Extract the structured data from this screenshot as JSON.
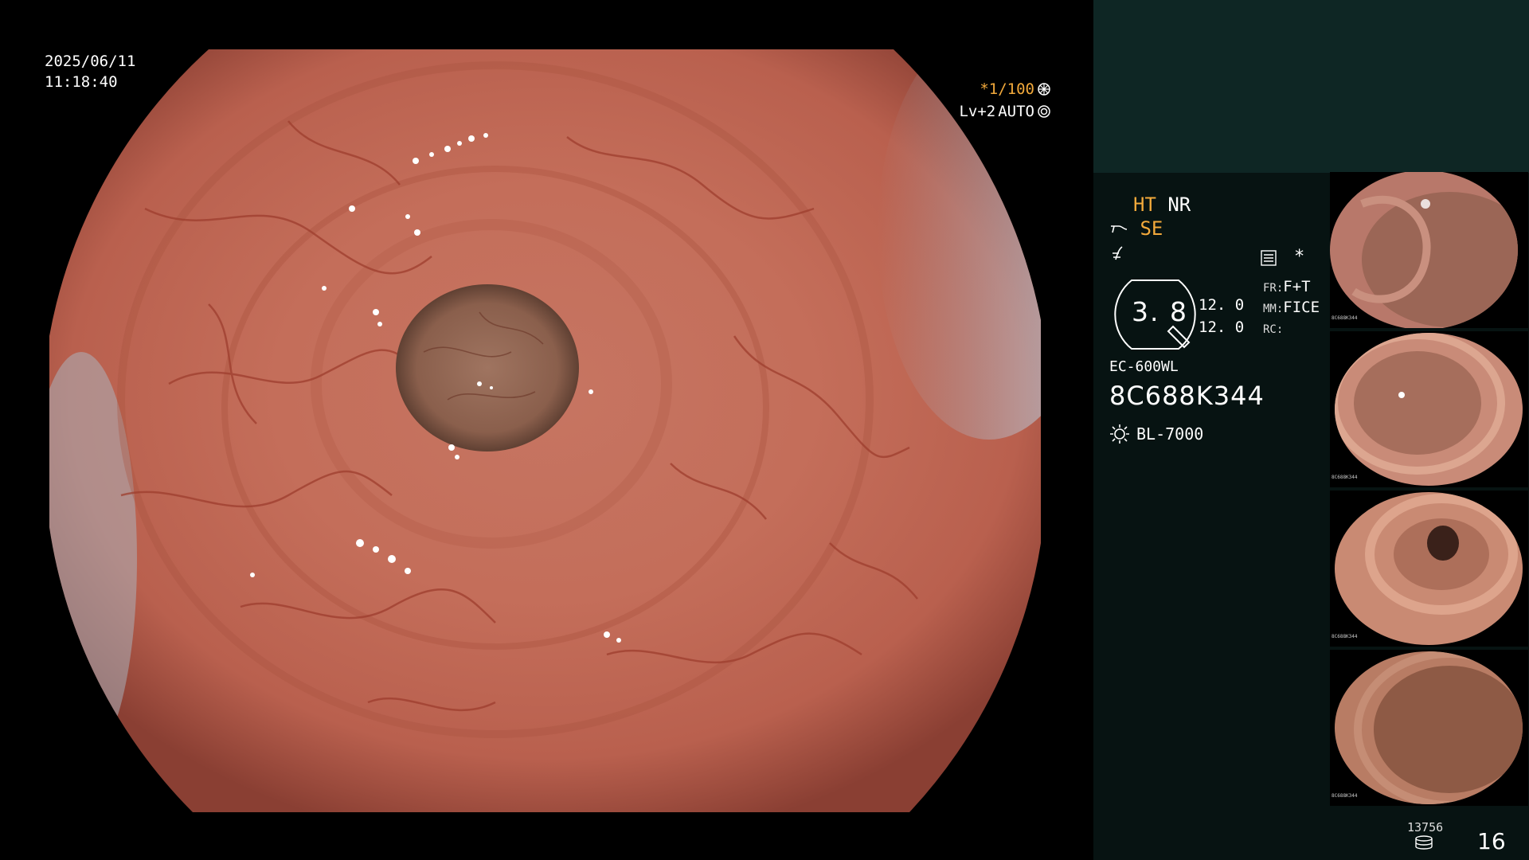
{
  "overlay": {
    "date": "2025/06/11",
    "time": "11:18:40",
    "shutter": "*1/100",
    "level": "Lv+2",
    "mode": "AUTO"
  },
  "panel": {
    "ht": "HT",
    "nr": "NR",
    "se": "SE",
    "asterisk": "*",
    "gauge_value": "3. 8",
    "gauge_num_1": "12. 0",
    "gauge_num_2": "12. 0",
    "fr_key": "FR:",
    "fr_value": "F+T",
    "mm_key": "MM:",
    "mm_value": "FICE",
    "rc_key": "RC:",
    "model": "EC-600WL",
    "serial": "8C688K344",
    "light_source": "BL-7000",
    "thumbnails": [
      {
        "caption": "8C688K344"
      },
      {
        "caption": "8C688K344"
      },
      {
        "caption": "8C688K344"
      },
      {
        "caption": "8C688K344"
      }
    ],
    "image_count": "13756",
    "page_number": "16"
  },
  "colors": {
    "accent": "#f2a93b",
    "panel_bg": "#071312",
    "panel_top": "#0e2624"
  },
  "icons": [
    "shutter-icon",
    "auto-iris-icon",
    "scope-icon",
    "wave-icon",
    "menu-icon",
    "light-source-icon",
    "storage-icon"
  ]
}
